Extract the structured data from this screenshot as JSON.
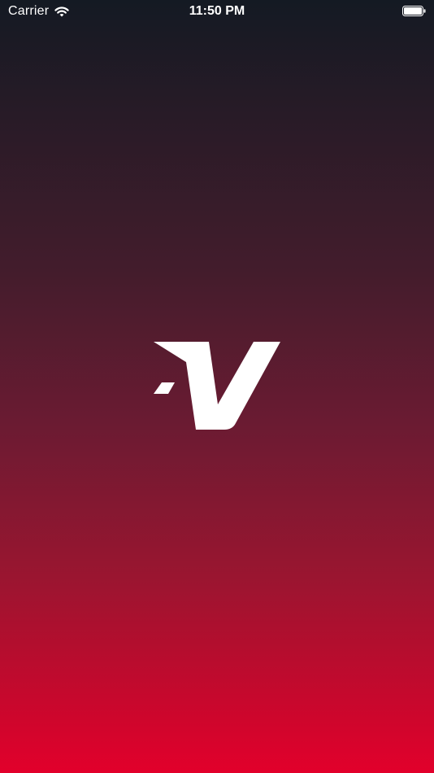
{
  "status_bar": {
    "carrier": "Carrier",
    "time": "11:50 PM",
    "icons": [
      "wifi-icon",
      "battery-icon"
    ]
  },
  "splash": {
    "logo_icon": "v-brand-logo-icon",
    "colors": {
      "gradient_top": "#141a23",
      "gradient_bottom": "#e2002b",
      "logo": "#ffffff"
    }
  }
}
